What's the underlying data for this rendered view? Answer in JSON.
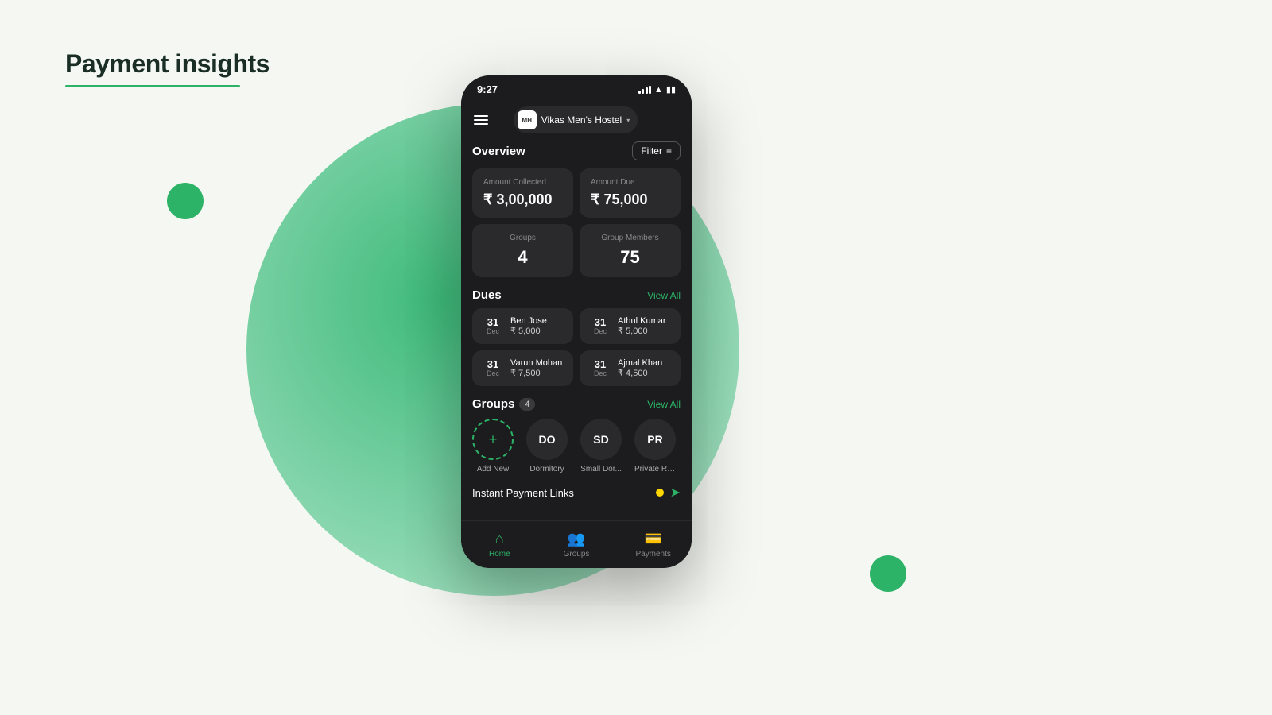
{
  "page": {
    "title": "Payment insights",
    "bg_color": "#f5f8f2"
  },
  "status_bar": {
    "time": "9:27"
  },
  "header": {
    "hostel_logo": "MH",
    "hostel_name": "Vikas Men's Hostel",
    "filter_label": "Filter"
  },
  "overview": {
    "label": "Overview",
    "amount_collected_label": "Amount Collected",
    "amount_collected_value": "₹ 3,00,000",
    "amount_due_label": "Amount Due",
    "amount_due_value": "₹ 75,000",
    "groups_label": "Groups",
    "groups_value": "4",
    "group_members_label": "Group Members",
    "group_members_value": "75"
  },
  "dues": {
    "label": "Dues",
    "view_all": "View All",
    "items": [
      {
        "day": "31",
        "month": "Dec",
        "name": "Ben Jose",
        "amount": "₹ 5,000"
      },
      {
        "day": "31",
        "month": "Dec",
        "name": "Athul Kumar",
        "amount": "₹ 5,000"
      },
      {
        "day": "31",
        "month": "Dec",
        "name": "Varun Mohan",
        "amount": "₹ 7,500"
      },
      {
        "day": "31",
        "month": "Dec",
        "name": "Ajmal Khan",
        "amount": "₹ 4,500"
      }
    ]
  },
  "groups": {
    "label": "Groups",
    "count": "4",
    "view_all": "View All",
    "items": [
      {
        "initials": "+",
        "label": "Add New",
        "type": "add"
      },
      {
        "initials": "DO",
        "label": "Dormitory",
        "type": "group"
      },
      {
        "initials": "SD",
        "label": "Small Dor...",
        "type": "group"
      },
      {
        "initials": "PR",
        "label": "Private Roo...",
        "type": "group"
      }
    ]
  },
  "payment_links": {
    "label": "Instant Payment Links"
  },
  "bottom_nav": {
    "items": [
      {
        "label": "Home",
        "active": true
      },
      {
        "label": "Groups",
        "active": false
      },
      {
        "label": "Payments",
        "active": false
      }
    ]
  }
}
